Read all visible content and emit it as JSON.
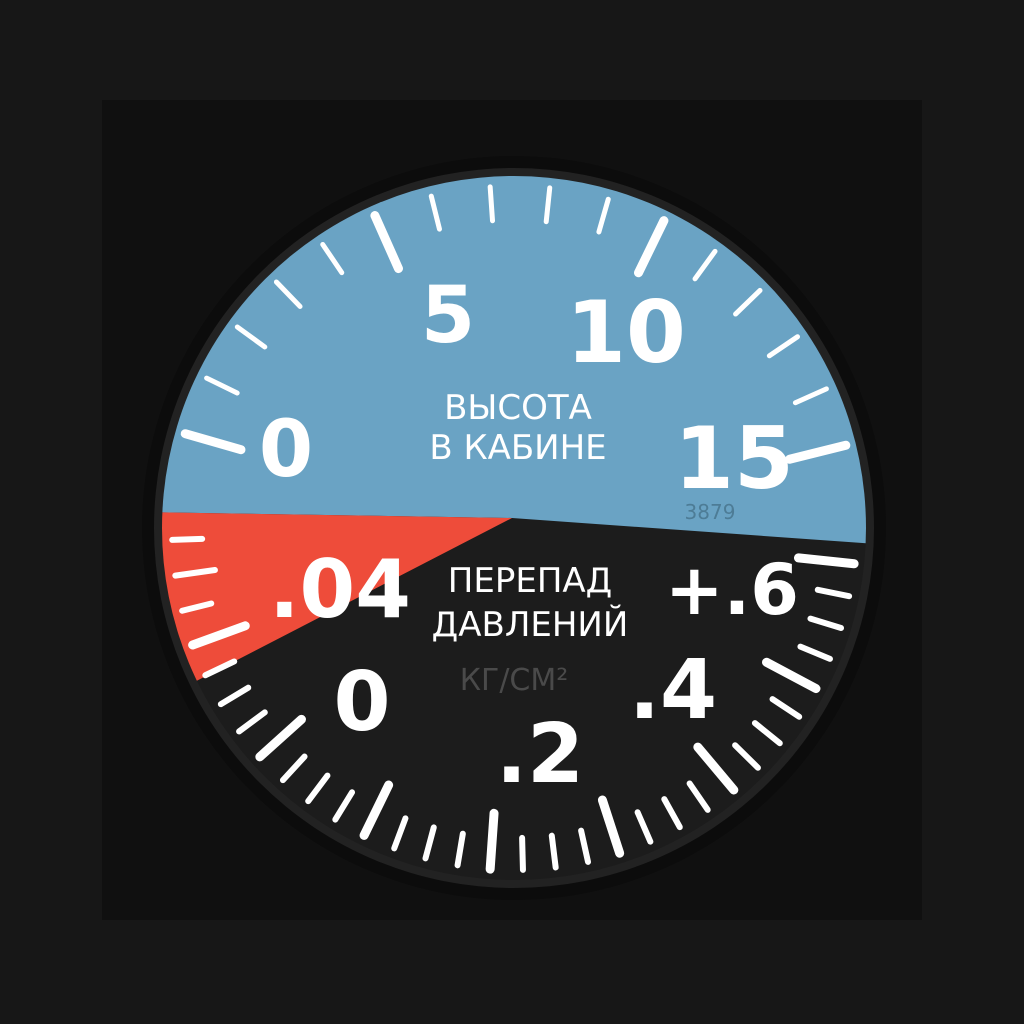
{
  "instrument": {
    "upper_scale": {
      "labels": [
        "0",
        "5",
        "10",
        "15"
      ],
      "title_line1": "ВЫСОТА",
      "title_line2": "В КАБИНЕ",
      "serial": "3879"
    },
    "lower_scale": {
      "labels": [
        ".04",
        "0",
        ".2",
        ".4",
        "+.6"
      ],
      "title_line1": "ПЕРЕПАД",
      "title_line2": "ДАВЛЕНИЙ",
      "unit": "КГ/СМ²"
    },
    "colors": {
      "upper_face": "#6aa3c4",
      "lower_face": "#1c1c1c",
      "warning_zone": "#ee4c3a",
      "bezel": "#0c0c0c",
      "markings": "#ffffff"
    }
  }
}
